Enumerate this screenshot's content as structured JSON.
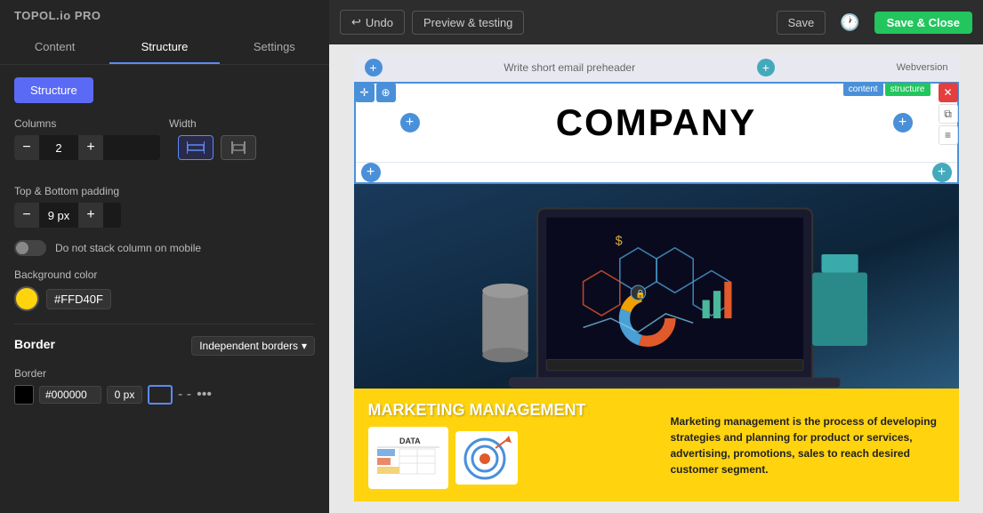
{
  "app": {
    "logo": "TOPOL.io PRO"
  },
  "topbar": {
    "undo_label": "Undo",
    "preview_label": "Preview & testing",
    "save_label": "Save",
    "save_close_label": "Save & Close"
  },
  "sidebar": {
    "tabs": [
      "Content",
      "Structure",
      "Settings"
    ],
    "active_tab": "Structure",
    "structure_button_label": "Structure",
    "columns_label": "Columns",
    "columns_value": "2",
    "width_label": "Width",
    "padding_label": "Top & Bottom padding",
    "padding_value": "9 px",
    "stack_label": "Do not stack column on mobile",
    "bg_color_label": "Background color",
    "bg_color_value": "#FFD40F",
    "border_section_label": "Border",
    "border_type_label": "Border",
    "border_type_option": "Independent borders",
    "border_color_value": "#000000",
    "border_px_value": "0 px"
  },
  "canvas": {
    "preheader_placeholder": "Write short email preheader",
    "webversion_label": "Webversion",
    "company_name": "COMPANY",
    "content_badge": "content",
    "structure_badge": "structure",
    "marketing_title": "MARKETING MANAGEMENT",
    "marketing_text": "Marketing management is the process of developing strategies and planning for product or services, advertising, promotions, sales to reach desired customer segment."
  },
  "icons": {
    "undo": "↩",
    "history": "🕐",
    "close": "✕",
    "copy": "⧉",
    "stack": "≡",
    "move": "✛",
    "plus": "+",
    "minus": "−",
    "chevron_down": "▾",
    "dots": "•••"
  }
}
